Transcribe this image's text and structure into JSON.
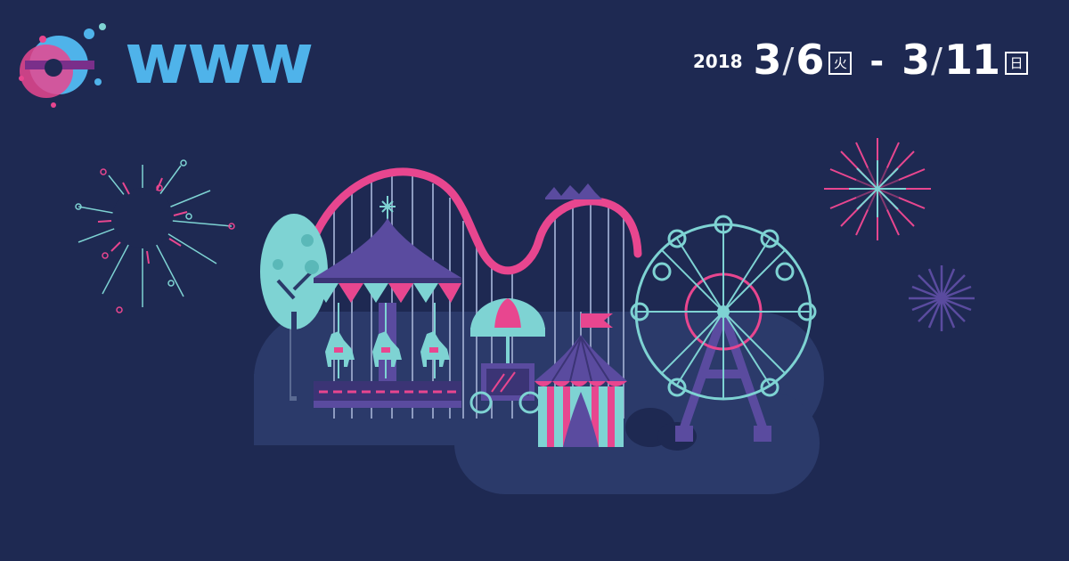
{
  "brand": {
    "wordmark": "www",
    "colors": {
      "primary": "#4fb3ea",
      "pink": "#e8468f",
      "teal": "#7ed3d3",
      "purple": "#5a4b9f",
      "background": "#1e2952"
    }
  },
  "event_dates": {
    "year": "2018",
    "start_date": "3",
    "start_day": "6",
    "start_weekday": "火",
    "separator": "-",
    "end_date": "3",
    "end_day": "11",
    "end_weekday": "日"
  },
  "illustration": {
    "scene": "amusement-park",
    "elements": [
      "fireworks",
      "roller-coaster",
      "carousel",
      "tree",
      "umbrella-cart",
      "circus-tent",
      "ferris-wheel",
      "bush"
    ]
  }
}
